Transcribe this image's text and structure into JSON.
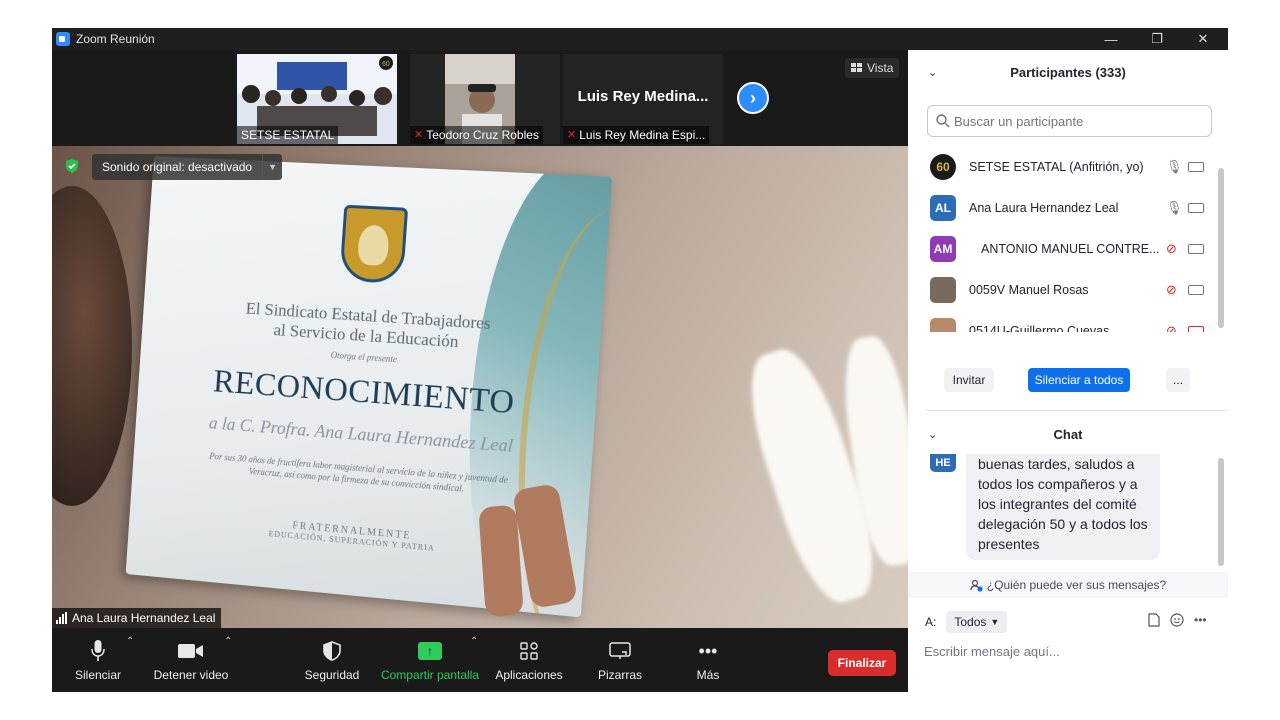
{
  "window": {
    "title": "Zoom Reunión",
    "controls": {
      "minimize": "—",
      "restore": "❐",
      "close": "✕"
    }
  },
  "thumbnails": [
    {
      "name": "SETSE ESTATAL",
      "muted": false
    },
    {
      "name": "Teodoro Cruz Robles",
      "muted": true
    },
    {
      "name": "Luis Rey Medina Espi...",
      "title": "Luis Rey Medina...",
      "muted": true
    }
  ],
  "view_button": {
    "label": "Vista"
  },
  "main_video": {
    "audio_status": "Sonido original: desactivado",
    "speaker_name": "Ana Laura Hernandez Leal",
    "certificate": {
      "line1": "El Sindicato Estatal de Trabajadores",
      "line1b": "al Servicio de la Educación",
      "line2": "Otorga el presente",
      "heading": "RECONOCIMIENTO",
      "recipient": "a la C. Profra. Ana Laura Hernandez Leal",
      "body": "Por sus 30 años de fructífera labor magisterial al servicio de la niñez y juventud de Veracruz, así como por la firmeza de su convicción sindical.",
      "closing": "FRATERNALMENTE",
      "motto": "EDUCACIÓN, SUPERACIÓN Y PATRIA"
    }
  },
  "toolbar": {
    "mute": "Silenciar",
    "stop_video": "Detener video",
    "security": "Seguridad",
    "share": "Compartir pantalla",
    "apps": "Aplicaciones",
    "whiteboards": "Pizarras",
    "more": "Más",
    "end": "Finalizar"
  },
  "participants_panel": {
    "title": "Participantes (333)",
    "search_placeholder": "Buscar un participante",
    "participants": [
      {
        "name": "SETSE ESTATAL (Anfitrión, yo)",
        "initials": "60",
        "avatar_color": "#1a1a1a",
        "mic_muted": false,
        "video_off": false
      },
      {
        "name": "Ana Laura Hernandez Leal",
        "initials": "AL",
        "avatar_color": "#2d6db5",
        "mic_muted": false,
        "video_off": false
      },
      {
        "name": "ANTONIO MANUEL CONTRE...",
        "initials": "AM",
        "avatar_color": "#8e3bb5",
        "mic_muted": true,
        "video_off": false
      },
      {
        "name": "0059V Manuel Rosas",
        "initials": "",
        "avatar_color": "#7a6a5e",
        "mic_muted": true,
        "video_off": false
      },
      {
        "name": "0514U-Guillermo Cuevas",
        "initials": "",
        "avatar_color": "#b88a6a",
        "mic_muted": true,
        "video_off": true
      }
    ],
    "invite": "Invitar",
    "mute_all": "Silenciar a todos",
    "more": "..."
  },
  "chat_panel": {
    "title": "Chat",
    "messages": [
      {
        "sender_initials": "HE",
        "text": "buenas tardes, saludos a todos los compañeros y a los integrantes del comité delegación 50  y a todos los presentes"
      }
    ],
    "who_can_see": "¿Quién puede ver sus mensajes?",
    "to_label": "A:",
    "recipient": "Todos",
    "input_placeholder": "Escribir mensaje aquí..."
  },
  "colors": {
    "accent": "#0e71eb",
    "end_button": "#d92c2c",
    "share_green": "#2ecc5a",
    "muted_red": "#e02828"
  }
}
